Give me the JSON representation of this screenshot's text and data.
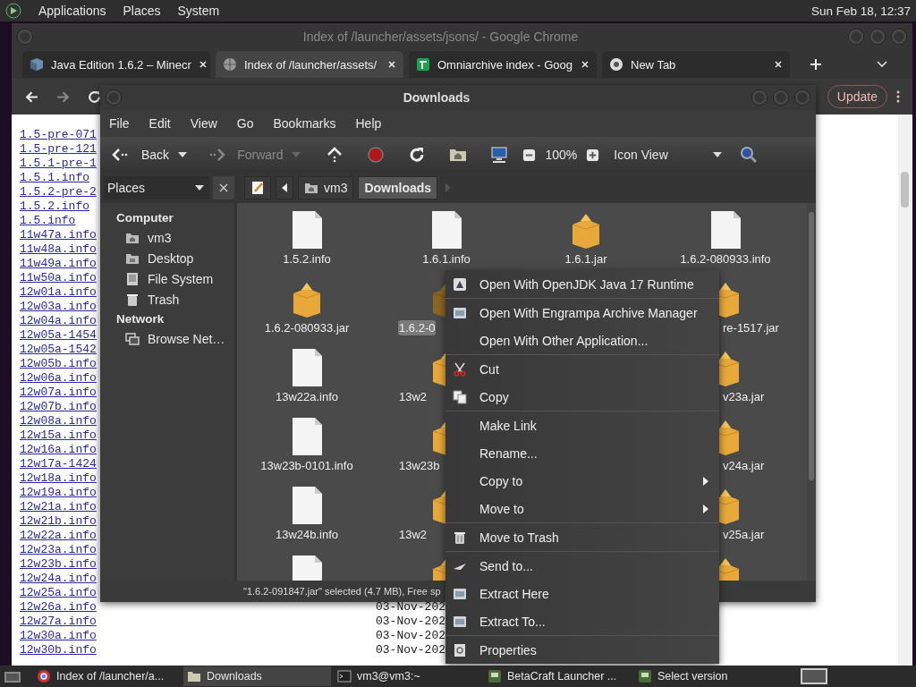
{
  "top_panel": {
    "menus": [
      "Applications",
      "Places",
      "System"
    ],
    "clock": "Sun Feb 18, 12:37"
  },
  "browser": {
    "title": "Index of /launcher/assets/jsons/ - Google Chrome",
    "tabs": [
      {
        "label": "Java Edition 1.6.2 – Minecr",
        "selected": false
      },
      {
        "label": "Index of /launcher/assets/",
        "selected": true
      },
      {
        "label": "Omniarchive index - Goog",
        "selected": false
      },
      {
        "label": "New Tab",
        "selected": false
      }
    ],
    "update_button": "Update",
    "listing": [
      {
        "name": "1.5-pre-071"
      },
      {
        "name": "1.5-pre-121"
      },
      {
        "name": "1.5.1-pre-1"
      },
      {
        "name": "1.5.1.info"
      },
      {
        "name": "1.5.2-pre-2"
      },
      {
        "name": "1.5.2.info"
      },
      {
        "name": "1.5.info"
      },
      {
        "name": "11w47a.info"
      },
      {
        "name": "11w48a.info"
      },
      {
        "name": "11w49a.info"
      },
      {
        "name": "11w50a.info"
      },
      {
        "name": "12w01a.info"
      },
      {
        "name": "12w03a.info"
      },
      {
        "name": "12w04a.info"
      },
      {
        "name": "12w05a-1454"
      },
      {
        "name": "12w05a-1542"
      },
      {
        "name": "12w05b.info"
      },
      {
        "name": "12w06a.info"
      },
      {
        "name": "12w07a.info"
      },
      {
        "name": "12w07b.info"
      },
      {
        "name": "12w08a.info"
      },
      {
        "name": "12w15a.info"
      },
      {
        "name": "12w16a.info"
      },
      {
        "name": "12w17a-1424"
      },
      {
        "name": "12w18a.info"
      },
      {
        "name": "12w19a.info"
      },
      {
        "name": "12w21a.info"
      },
      {
        "name": "12w21b.info"
      },
      {
        "name": "12w22a.info"
      },
      {
        "name": "12w23a.info"
      },
      {
        "name": "12w23b.info"
      },
      {
        "name": "12w24a.info"
      },
      {
        "name": "12w25a.info"
      },
      {
        "name": "12w26a.info",
        "date": "03-Nov-202"
      },
      {
        "name": "12w27a.info",
        "date": "03-Nov-202"
      },
      {
        "name": "12w30a.info",
        "date": "03-Nov-202"
      },
      {
        "name": "12w30b.info",
        "date": "03-Nov-202"
      }
    ]
  },
  "file_manager": {
    "title": "Downloads",
    "menus": [
      "File",
      "Edit",
      "View",
      "Go",
      "Bookmarks",
      "Help"
    ],
    "toolbar": {
      "back": "Back",
      "forward": "Forward",
      "forward_disabled": true,
      "zoom": "100%",
      "view": "Icon View"
    },
    "places_selector": "Places",
    "path": [
      {
        "label": "vm3",
        "selected": false
      },
      {
        "label": "Downloads",
        "selected": true
      }
    ],
    "sidebar": [
      {
        "heading": "Computer",
        "items": [
          "vm3",
          "Desktop",
          "File System",
          "Trash"
        ]
      },
      {
        "heading": "Network",
        "items": [
          "Browse Net…"
        ]
      }
    ],
    "files": [
      {
        "kind": "file",
        "label": "1.5.2.info",
        "selected": false,
        "covered_right": false,
        "covered_left": false
      },
      {
        "kind": "file",
        "label": "1.6.1.info",
        "selected": false,
        "covered_right": false,
        "covered_left": false
      },
      {
        "kind": "package",
        "label": "1.6.1.jar",
        "selected": false,
        "covered_right": false,
        "covered_left": false
      },
      {
        "kind": "file",
        "label": "1.6.2-080933.info",
        "selected": false,
        "covered_right": false,
        "covered_left": false
      },
      {
        "kind": "package",
        "label": "1.6.2-080933.jar",
        "selected": false,
        "covered_right": false,
        "covered_left": false
      },
      {
        "kind": "package",
        "label": "1.6.2-0",
        "selected": true,
        "covered_right": true,
        "covered_left": false
      },
      {
        "kind": "package",
        "label": "re-1517.jar",
        "selected": false,
        "covered_right": false,
        "covered_left": true
      },
      {
        "kind": "file",
        "label": "13w22a.info",
        "selected": false,
        "covered_right": false,
        "covered_left": false
      },
      {
        "kind": "package",
        "label": "13w2",
        "selected": false,
        "covered_right": true,
        "covered_left": false
      },
      {
        "kind": "package",
        "label": "v23a.jar",
        "selected": false,
        "covered_right": false,
        "covered_left": true
      },
      {
        "kind": "file",
        "label": "13w23b-0101.info",
        "selected": false,
        "covered_right": false,
        "covered_left": false
      },
      {
        "kind": "package",
        "label": "13w23b",
        "selected": false,
        "covered_right": true,
        "covered_left": false
      },
      {
        "kind": "package",
        "label": "v24a.jar",
        "selected": false,
        "covered_right": false,
        "covered_left": true
      },
      {
        "kind": "file",
        "label": "13w24b.info",
        "selected": false,
        "covered_right": false,
        "covered_left": false
      },
      {
        "kind": "package",
        "label": "13w2",
        "selected": false,
        "covered_right": true,
        "covered_left": false
      },
      {
        "kind": "package",
        "label": "v25a.jar",
        "selected": false,
        "covered_right": false,
        "covered_left": true
      },
      {
        "kind": "file",
        "selected": false
      },
      {
        "kind": "package",
        "selected": false
      },
      {
        "kind": "package",
        "selected": false,
        "covered_left": true
      }
    ],
    "status": "\"1.6.2-091847.jar\" selected (4.7 MB), Free sp"
  },
  "context_menu": [
    {
      "kind": "item",
      "label": "Open With OpenJDK Java 17 Runtime",
      "submenu": false
    },
    {
      "kind": "separator"
    },
    {
      "kind": "item",
      "label": "Open With Engrampa Archive Manager",
      "submenu": false
    },
    {
      "kind": "item",
      "label": "Open With Other Application...",
      "submenu": false
    },
    {
      "kind": "separator"
    },
    {
      "kind": "item",
      "label": "Cut",
      "submenu": false
    },
    {
      "kind": "item",
      "label": "Copy",
      "submenu": false
    },
    {
      "kind": "separator"
    },
    {
      "kind": "item",
      "label": "Make Link",
      "submenu": false
    },
    {
      "kind": "item",
      "label": "Rename...",
      "submenu": false
    },
    {
      "kind": "item",
      "label": "Copy to",
      "submenu": true
    },
    {
      "kind": "item",
      "label": "Move to",
      "submenu": true
    },
    {
      "kind": "separator"
    },
    {
      "kind": "item",
      "label": "Move to Trash",
      "submenu": false
    },
    {
      "kind": "separator"
    },
    {
      "kind": "item",
      "label": "Send to...",
      "submenu": false
    },
    {
      "kind": "item",
      "label": "Extract Here",
      "submenu": false
    },
    {
      "kind": "item",
      "label": "Extract To...",
      "submenu": false
    },
    {
      "kind": "separator"
    },
    {
      "kind": "item",
      "label": "Properties",
      "submenu": false
    }
  ],
  "taskbar": [
    {
      "label": "Index of /launcher/a...",
      "selected": false
    },
    {
      "label": "Downloads",
      "selected": true
    },
    {
      "label": "vm3@vm3:~",
      "selected": false
    },
    {
      "label": "BetaCraft Launcher ...",
      "selected": false
    },
    {
      "label": "Select version",
      "selected": false
    }
  ]
}
